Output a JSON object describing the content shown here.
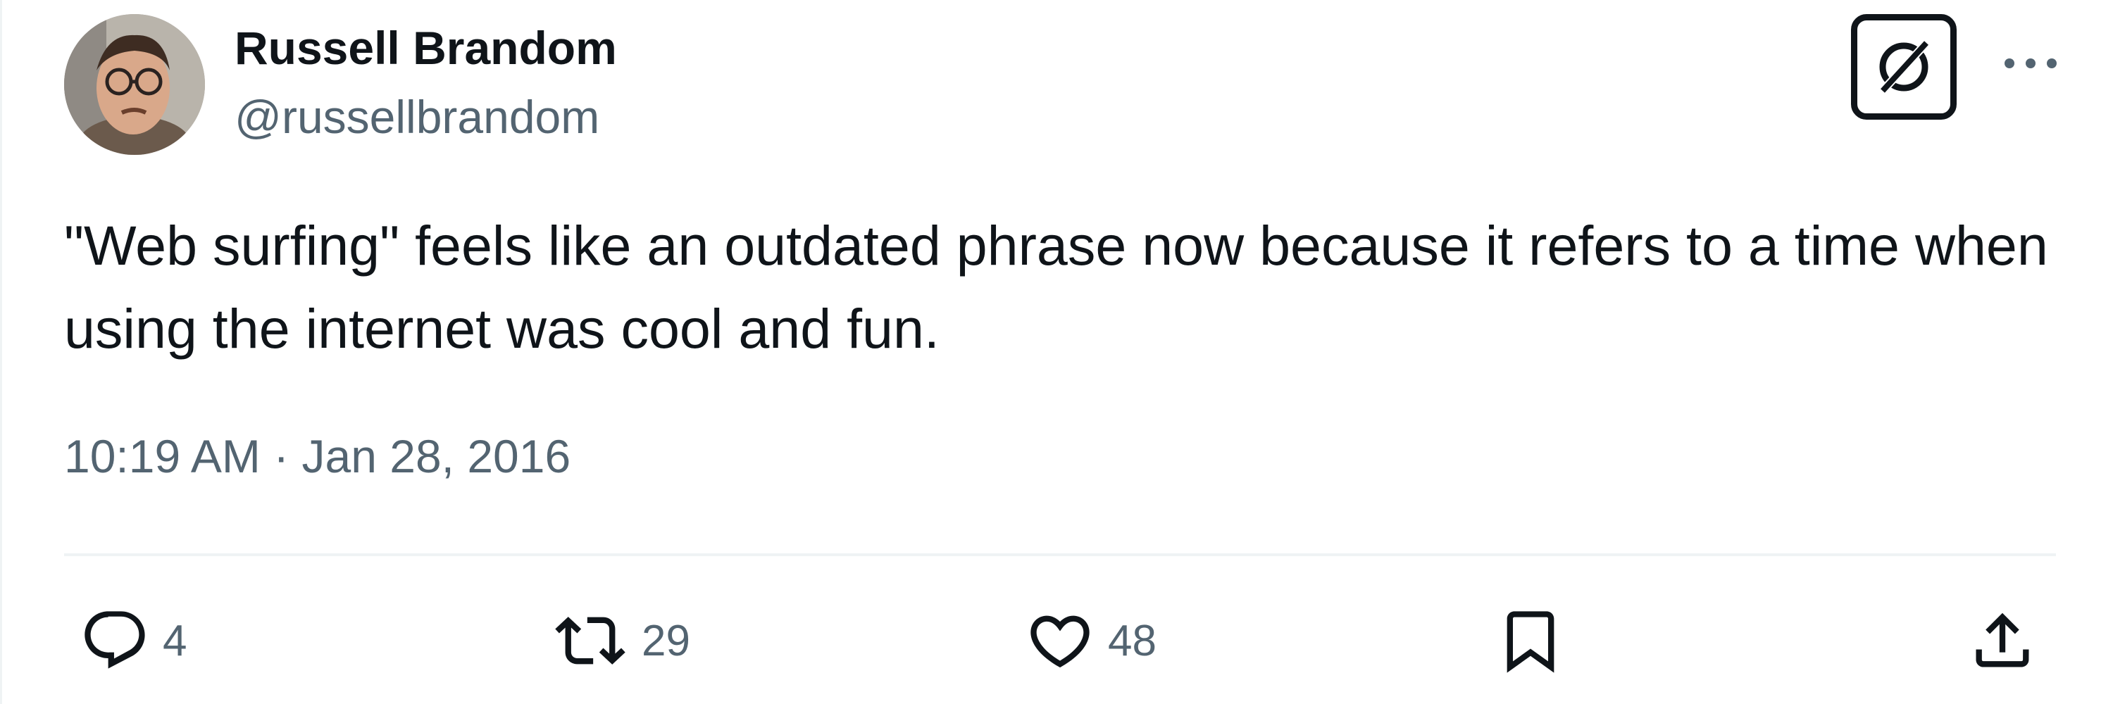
{
  "author": {
    "display_name": "Russell Brandom",
    "handle": "@russellbrandom"
  },
  "tweet": {
    "text": "\"Web surfing\" feels like an outdated phrase now because it refers to a time when using the internet was cool and fun.",
    "timestamp": "10:19 AM · Jan 28, 2016"
  },
  "actions": {
    "replies": "4",
    "retweets": "29",
    "likes": "48"
  },
  "icons": {
    "grok": "grok-icon",
    "more": "more-icon",
    "reply": "reply-icon",
    "retweet": "retweet-icon",
    "like": "heart-icon",
    "bookmark": "bookmark-icon",
    "share": "share-icon"
  },
  "colors": {
    "text": "#0f1419",
    "secondary": "#536471",
    "divider": "#eff3f4"
  }
}
